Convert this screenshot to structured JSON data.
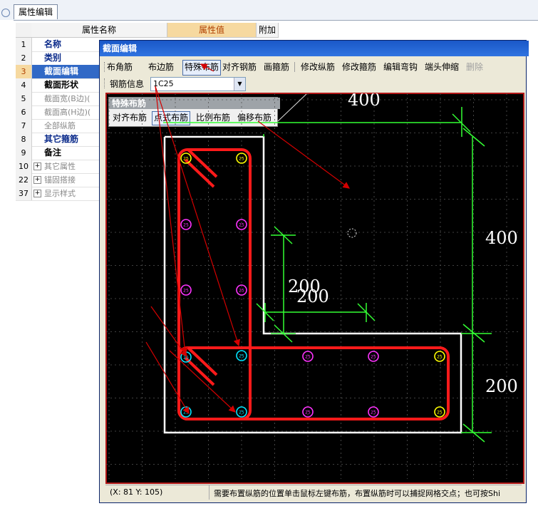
{
  "panel_tab": "属性编辑",
  "grid": {
    "col_name": "属性名称",
    "col_value": "属性值",
    "col_extra": "附加",
    "rows": [
      {
        "num": "1",
        "label": "名称",
        "style": "link"
      },
      {
        "num": "2",
        "label": "类别",
        "style": "link"
      },
      {
        "num": "3",
        "label": "截面编辑",
        "style": "selected"
      },
      {
        "num": "4",
        "label": "截面形状",
        "style": "bold"
      },
      {
        "num": "5",
        "label": "截面宽(B边)(",
        "style": "grey"
      },
      {
        "num": "6",
        "label": "截面高(H边)(",
        "style": "grey"
      },
      {
        "num": "7",
        "label": "全部纵筋",
        "style": "grey"
      },
      {
        "num": "8",
        "label": "其它箍筋",
        "style": "link"
      },
      {
        "num": "9",
        "label": "备注",
        "style": "bold"
      },
      {
        "num": "10",
        "label": "其它属性",
        "style": "grey",
        "expand": true
      },
      {
        "num": "22",
        "label": "锚固搭接",
        "style": "grey",
        "expand": true
      },
      {
        "num": "37",
        "label": "显示样式",
        "style": "grey",
        "expand": true
      }
    ]
  },
  "dialog": {
    "title": "截面编辑",
    "toolbar": [
      "布角筋",
      "布边筋",
      "特殊布筋",
      "对齐钢筋",
      "画箍筋",
      "修改纵筋",
      "修改箍筋",
      "编辑弯钩",
      "端头伸缩",
      "删除"
    ],
    "toolbar_active": "特殊布筋",
    "rebar_label": "钢筋信息",
    "rebar_value": "1C25",
    "special_title": "特殊布筋",
    "special_buttons": [
      "对齐布筋",
      "点式布筋",
      "比例布筋",
      "偏移布筋"
    ],
    "special_active": "点式布筋",
    "status_coord": "(X: 81 Y: 105)",
    "status_msg": "需要布置纵筋的位置单击鼠标左键布筋，布置纵筋时可以捕捉网格交点；也可按Shi"
  },
  "drawing": {
    "dim_top": "400",
    "dim_right_upper": "400",
    "dim_right_lower": "200",
    "dim_inner_a": "200",
    "dim_inner_b": "200",
    "bar_label": "25",
    "colors": {
      "outline": "#ffffff",
      "stirrup": "#ff1a1a",
      "dimension": "#33ff33",
      "corner_bar": "#ffff00",
      "edge_bar": "#ff33ff",
      "new_bar": "#00e5ff",
      "arrow": "#d40000"
    }
  }
}
